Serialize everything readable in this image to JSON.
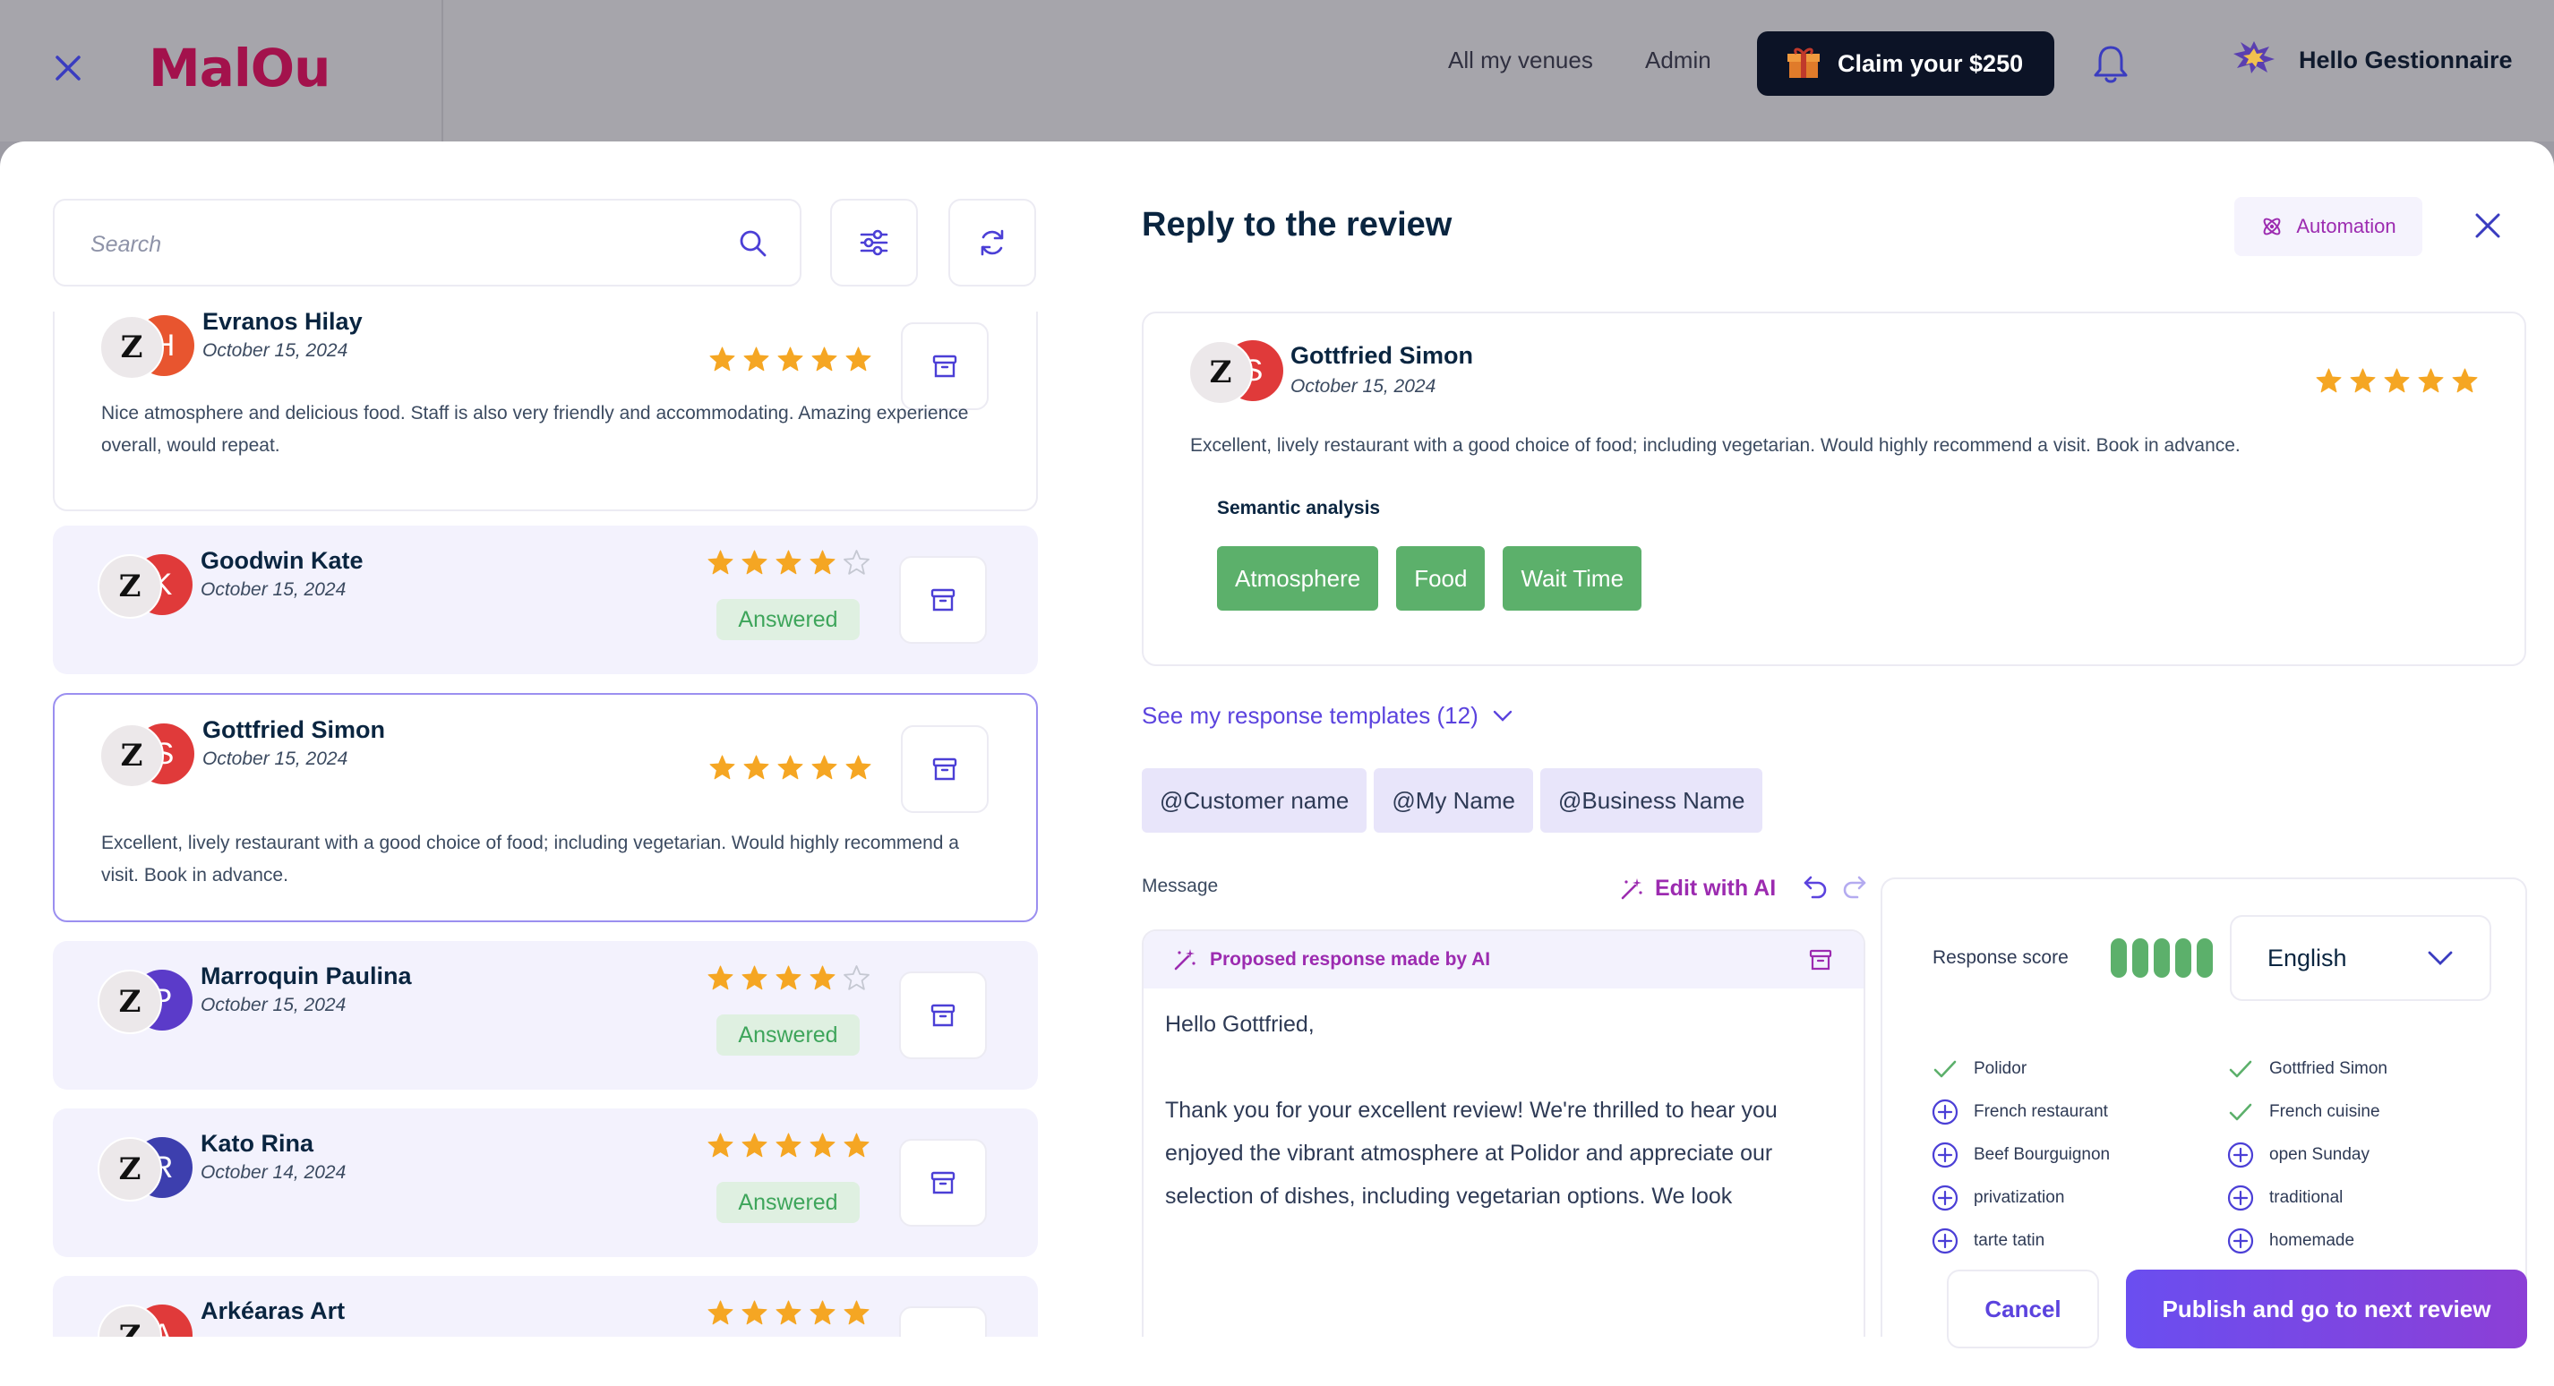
{
  "topbar": {
    "logo": "MalOu",
    "nav": [
      "All my venues",
      "Admin"
    ],
    "claim_label": "Claim your $250",
    "greeting": "Hello Gestionnaire"
  },
  "search": {
    "placeholder": "Search",
    "value": ""
  },
  "reviews": [
    {
      "name": "Evranos Hilay",
      "initial": "H",
      "avatar_color": "#e8552f",
      "date": "October 15, 2024",
      "rating": 5,
      "answered": false,
      "text": "Nice atmosphere and delicious food. Staff is also very friendly and accommodating. Amazing experience overall, would repeat."
    },
    {
      "name": "Goodwin Kate",
      "initial": "K",
      "avatar_color": "#e03a3a",
      "date": "October 15, 2024",
      "rating": 4,
      "answered": true,
      "status": "Answered"
    },
    {
      "name": "Gottfried Simon",
      "initial": "S",
      "avatar_color": "#e03a3a",
      "date": "October 15, 2024",
      "rating": 5,
      "answered": false,
      "text": "Excellent, lively restaurant with a good choice of food; including vegetarian. Would highly recommend a visit. Book in advance."
    },
    {
      "name": "Marroquin Paulina",
      "initial": "P",
      "avatar_color": "#5b3bc9",
      "date": "October 15, 2024",
      "rating": 4,
      "answered": true,
      "status": "Answered"
    },
    {
      "name": "Kato Rina",
      "initial": "R",
      "avatar_color": "#3d3fae",
      "date": "October 14, 2024",
      "rating": 5,
      "answered": true,
      "status": "Answered"
    },
    {
      "name": "Arkéaras Art",
      "initial": "A",
      "avatar_color": "#e03a3a",
      "date": "",
      "rating": 5,
      "answered": false
    }
  ],
  "reply": {
    "title": "Reply to the review",
    "automation_label": "Automation",
    "review": {
      "name": "Gottfried Simon",
      "initial": "S",
      "date": "October 15, 2024",
      "rating": 5,
      "text": "Excellent, lively restaurant with a good choice of food; including vegetarian. Would highly recommend a visit. Book in advance."
    },
    "semantic_title": "Semantic analysis",
    "semantic_tags": [
      "Atmosphere",
      "Food",
      "Wait Time"
    ],
    "templates_link": "See my response templates (12)",
    "variables": [
      "@Customer name",
      "@My Name",
      "@Business Name"
    ],
    "message_label": "Message",
    "edit_ai_label": "Edit with AI",
    "ai_banner": "Proposed response made by AI",
    "message_text": "Hello Gottfried,\n\nThank you for your excellent review! We're thrilled to hear you enjoyed the vibrant atmosphere at Polidor and appreciate our selection of dishes, including vegetarian options. We look",
    "score_label": "Response score",
    "score_value": 5,
    "language": "English",
    "keywords_left": [
      {
        "label": "Polidor",
        "done": true
      },
      {
        "label": "French restaurant",
        "done": false
      },
      {
        "label": "Beef Bourguignon",
        "done": false
      },
      {
        "label": "privatization",
        "done": false
      },
      {
        "label": "tarte tatin",
        "done": false
      }
    ],
    "keywords_right": [
      {
        "label": "Gottfried Simon",
        "done": true
      },
      {
        "label": "French cuisine",
        "done": true
      },
      {
        "label": "open Sunday",
        "done": false
      },
      {
        "label": "traditional",
        "done": false
      },
      {
        "label": "homemade",
        "done": false
      }
    ],
    "cancel_label": "Cancel",
    "publish_label": "Publish and go to next review"
  },
  "colors": {
    "accent": "#5b43de",
    "ai_purple": "#9c2bb0",
    "green": "#5cb06b",
    "star": "#f5a623",
    "logo": "#a3124c"
  }
}
